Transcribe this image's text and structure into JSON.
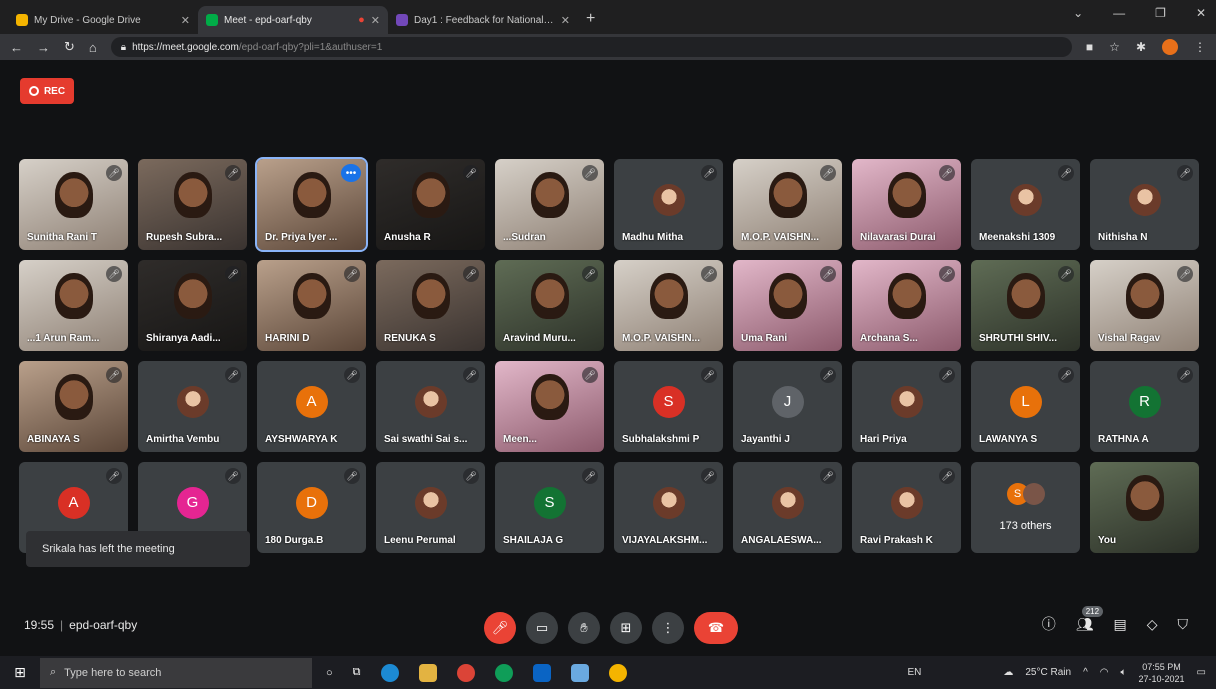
{
  "browser": {
    "tabs": [
      {
        "title": "My Drive - Google Drive",
        "fav_color": "#f4b400",
        "active": false
      },
      {
        "title": "Meet - epd-oarf-qby",
        "fav_color": "#00ac47",
        "active": true
      },
      {
        "title": "Day1 : Feedback for National Le",
        "fav_color": "#7248b9",
        "active": false
      }
    ],
    "url_main": "https://meet.google.com",
    "url_rest": "/epd-oarf-qby?pli=1&authuser=1"
  },
  "rec_label": "REC",
  "tiles": [
    {
      "name": "Sunitha Rani T",
      "kind": "video",
      "style": "v5"
    },
    {
      "name": "Rupesh Subra...",
      "kind": "video",
      "style": "video"
    },
    {
      "name": "Dr. Priya Iyer ...",
      "kind": "video",
      "style": "v2",
      "highlight": true,
      "more": true
    },
    {
      "name": "Anusha R",
      "kind": "video",
      "style": "v4"
    },
    {
      "name": "...Sudran",
      "kind": "video",
      "style": "v5"
    },
    {
      "name": "Madhu Mitha",
      "kind": "photo"
    },
    {
      "name": "M.O.P. VAISHN...",
      "kind": "video",
      "style": "v5"
    },
    {
      "name": "Nilavarasi Durai",
      "kind": "video",
      "style": "v3"
    },
    {
      "name": "Meenakshi 1309",
      "kind": "photo"
    },
    {
      "name": "Nithisha N",
      "kind": "photo"
    },
    {
      "name": "...1 Arun Ram...",
      "kind": "video",
      "style": "v5"
    },
    {
      "name": "Shiranya Aadi...",
      "kind": "video",
      "style": "v4"
    },
    {
      "name": "HARINI D",
      "kind": "video",
      "style": "v2"
    },
    {
      "name": "RENUKA S",
      "kind": "video",
      "style": "video"
    },
    {
      "name": "Aravind Muru...",
      "kind": "video",
      "style": "v6"
    },
    {
      "name": "M.O.P. VAISHN...",
      "kind": "video",
      "style": "v5"
    },
    {
      "name": "Uma Rani",
      "kind": "video",
      "style": "v3"
    },
    {
      "name": "Archana S...",
      "kind": "video",
      "style": "v3"
    },
    {
      "name": "SHRUTHI SHIV...",
      "kind": "video",
      "style": "v6"
    },
    {
      "name": "Vishal Ragav",
      "kind": "video",
      "style": "v5"
    },
    {
      "name": "ABINAYA S",
      "kind": "video",
      "style": "v2"
    },
    {
      "name": "Amirtha Vembu",
      "kind": "photo"
    },
    {
      "name": "AYSHWARYA K",
      "kind": "letter",
      "letter": "A",
      "color": "#e8710a"
    },
    {
      "name": "Sai swathi Sai s...",
      "kind": "photo"
    },
    {
      "name": "Meen...",
      "kind": "video",
      "style": "v3"
    },
    {
      "name": "Subhalakshmi P",
      "kind": "letter",
      "letter": "S",
      "color": "#d93025"
    },
    {
      "name": "Jayanthi J",
      "kind": "letter",
      "letter": "J",
      "color": "#5f6368"
    },
    {
      "name": "Hari Priya",
      "kind": "photo"
    },
    {
      "name": "LAWANYA S",
      "kind": "letter",
      "letter": "L",
      "color": "#e8710a"
    },
    {
      "name": "RATHNA A",
      "kind": "letter",
      "letter": "R",
      "color": "#137333"
    },
    {
      "name": "",
      "kind": "letter",
      "letter": "A",
      "color": "#d93025"
    },
    {
      "name": "",
      "kind": "letter",
      "letter": "G",
      "color": "#e52592"
    },
    {
      "name": "180 Durga.B",
      "kind": "letter",
      "letter": "D",
      "color": "#e8710a"
    },
    {
      "name": "Leenu Perumal",
      "kind": "photo"
    },
    {
      "name": "SHAILAJA G",
      "kind": "letter",
      "letter": "S",
      "color": "#137333"
    },
    {
      "name": "VIJAYALAKSHM...",
      "kind": "photo"
    },
    {
      "name": "ANGALAESWA...",
      "kind": "photo"
    },
    {
      "name": "Ravi Prakash K",
      "kind": "photo"
    },
    {
      "name": "173 others",
      "kind": "others"
    },
    {
      "name": "You",
      "kind": "video",
      "style": "v6"
    }
  ],
  "toast": "Srikala has left the meeting",
  "meeting": {
    "time": "19:55",
    "code": "epd-oarf-qby",
    "participant_count": "212"
  },
  "taskbar": {
    "search_placeholder": "Type here to search",
    "lang": "EN",
    "weather": "25°C Rain",
    "time": "07:55 PM",
    "date": "27-10-2021"
  }
}
